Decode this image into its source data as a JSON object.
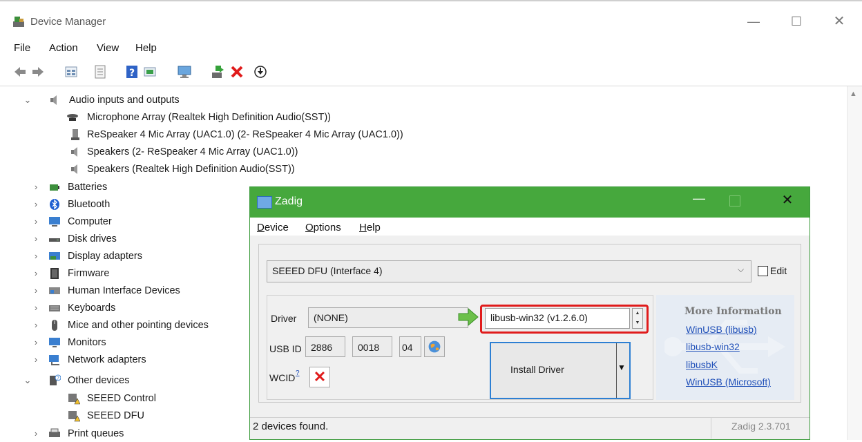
{
  "device_manager": {
    "title": "Device Manager",
    "window_controls": {
      "minimize": "—",
      "maximize": "☐",
      "close": "✕"
    },
    "menu": [
      "File",
      "Action",
      "View",
      "Help"
    ],
    "tree": {
      "audio": {
        "label": "Audio inputs and outputs",
        "children": [
          "Microphone Array (Realtek High Definition Audio(SST))",
          "ReSpeaker 4 Mic Array (UAC1.0)  (2- ReSpeaker 4 Mic Array (UAC1.0))",
          "Speakers (2- ReSpeaker 4 Mic Array (UAC1.0))",
          "Speakers (Realtek High Definition Audio(SST))"
        ]
      },
      "categories": [
        "Batteries",
        "Bluetooth",
        "Computer",
        "Disk drives",
        "Display adapters",
        "Firmware",
        "Human Interface Devices",
        "Keyboards",
        "Mice and other pointing devices",
        "Monitors",
        "Network adapters"
      ],
      "other": {
        "label": "Other devices",
        "children": [
          "SEEED Control",
          "SEEED DFU"
        ]
      },
      "print_queues": "Print queues"
    }
  },
  "zadig": {
    "title": "Zadig",
    "window_controls": {
      "minimize": "—",
      "close": "✕"
    },
    "menu": [
      {
        "u": "D",
        "rest": "evice"
      },
      {
        "u": "O",
        "rest": "ptions"
      },
      {
        "u": "H",
        "rest": "elp"
      }
    ],
    "device_selected": "SEEED DFU (Interface 4)",
    "edit_label": "Edit",
    "driver_label": "Driver",
    "driver_value": "(NONE)",
    "target_driver": "libusb-win32 (v1.2.6.0)",
    "usb_id_label": "USB ID",
    "usb_id": [
      "2886",
      "0018",
      "04"
    ],
    "wcid_label": "WCID",
    "wcid_sup": "?",
    "install_button": "Install Driver",
    "more_info": {
      "title": "More Information",
      "links": [
        "WinUSB (libusb)",
        "libusb-win32",
        "libusbK",
        "WinUSB (Microsoft)"
      ]
    },
    "status": "2 devices found.",
    "version": "Zadig 2.3.701"
  }
}
